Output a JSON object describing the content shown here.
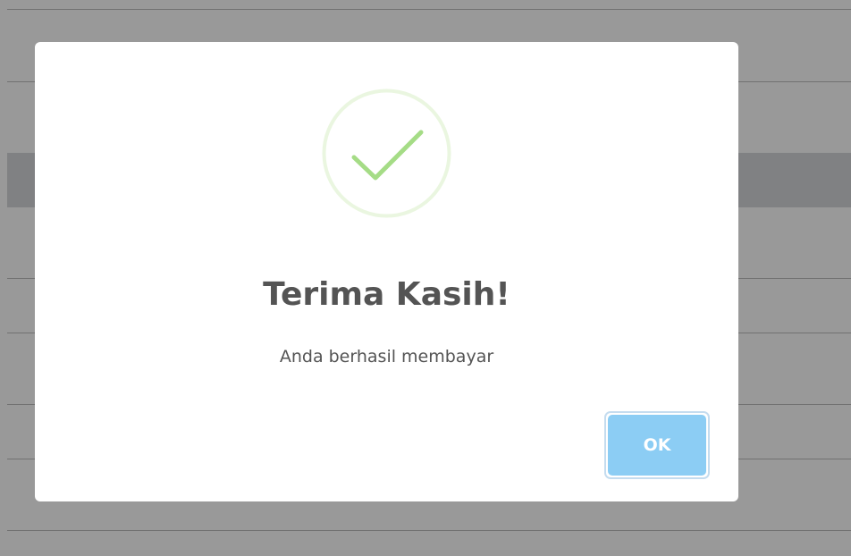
{
  "dialog": {
    "title": "Terima Kasih!",
    "message": "Anda berhasil membayar",
    "confirm_label": "OK",
    "icon": "checkmark-icon"
  },
  "colors": {
    "success": "#a5dc86",
    "success_ring": "#eaf6e0",
    "button": "#8ccdf4",
    "text": "#545454"
  }
}
